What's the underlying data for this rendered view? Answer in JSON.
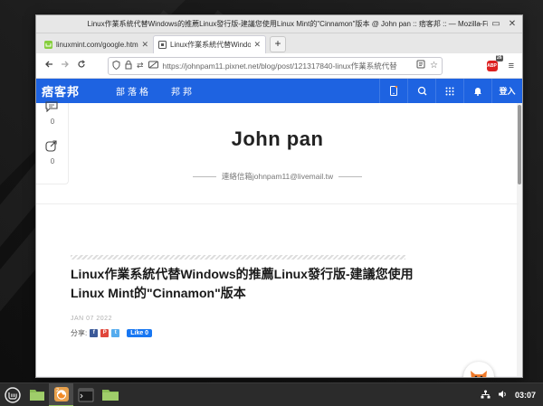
{
  "window": {
    "title": "Linux作業系統代替Windows的推薦Linux發行版-建議您使用Linux Mint的\"Cinnamon\"版本 @ John pan :: 痞客邦 :: — Mozilla Firefox",
    "controls": [
      "–",
      "▭",
      "✕"
    ]
  },
  "tabs": [
    {
      "label": "linuxmint.com/google.html",
      "icon": "linuxmint-favicon",
      "active": false
    },
    {
      "label": "Linux作業系統代替Windows",
      "icon": "pixnet-favicon",
      "active": true
    }
  ],
  "navbar": {
    "url": "https://johnpam11.pixnet.net/blog/post/121317840-linux作業系統代替",
    "abp_label": "ABP",
    "abp_badge": "26"
  },
  "site": {
    "logo": "痞客邦",
    "nav": [
      "部落格",
      "邦邦"
    ],
    "login": "登入"
  },
  "share_sidebar": {
    "comment_count": "0",
    "share_count": "0"
  },
  "blog": {
    "title": "John pan",
    "contact": "連絡信箱johnpam11@livemail.tw"
  },
  "post": {
    "title": "Linux作業系統代替Windows的推薦Linux發行版-建議您使用Linux Mint的\"Cinnamon\"版本",
    "date": "JAN 07 2022",
    "share_label": "分享:",
    "like_label": "Like 0"
  },
  "taskbar": {
    "clock": "03:07"
  }
}
